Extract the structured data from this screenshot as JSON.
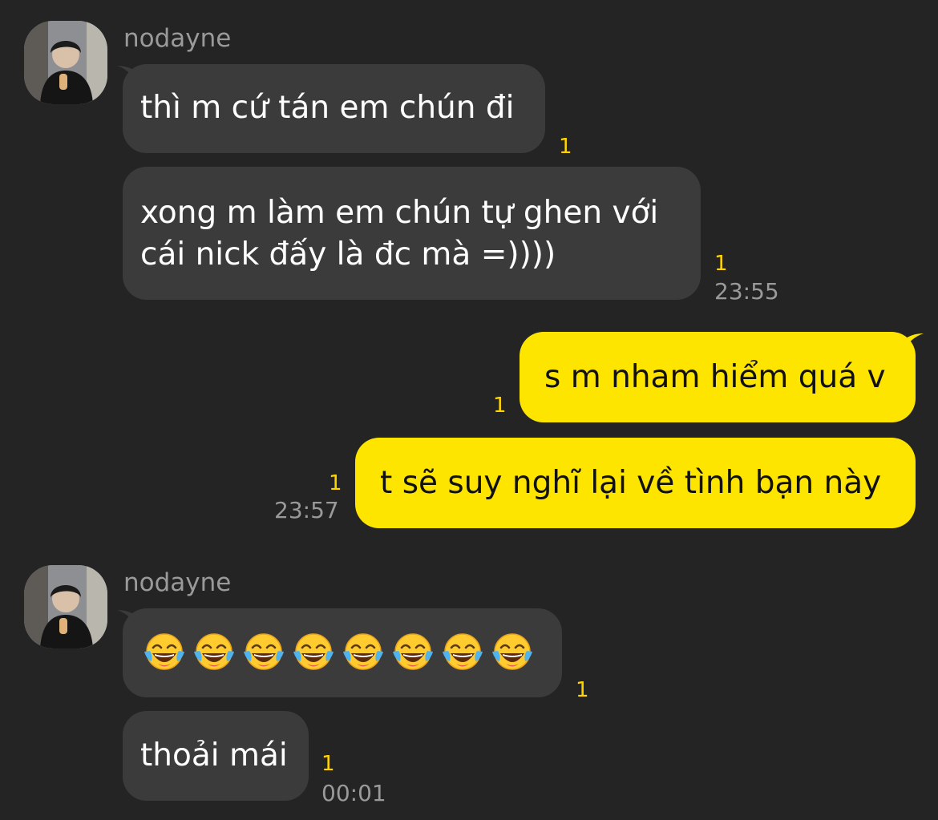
{
  "chat": {
    "groups": [
      {
        "sender": "nodayne",
        "messages": [
          {
            "text": "thì m cứ tán em chún đi",
            "read_count": "1"
          },
          {
            "lines": [
              "xong m làm em chún tự ghen với",
              "cái nick đấy là đc mà =))))"
            ],
            "read_count": "1",
            "time": "23:55"
          }
        ]
      },
      {
        "sender": "me",
        "messages": [
          {
            "text": "s m nham hiểm quá v",
            "read_count": "1"
          },
          {
            "text": "t sẽ suy nghĩ lại về tình bạn này",
            "read_count": "1",
            "time": "23:57"
          }
        ]
      },
      {
        "sender": "nodayne",
        "messages": [
          {
            "emoji": "face-with-tears-of-joy",
            "emoji_count": 8,
            "read_count": "1"
          },
          {
            "text": "thoải mái",
            "read_count": "1",
            "time": "00:01"
          }
        ]
      }
    ]
  },
  "colors": {
    "background": "#242424",
    "incoming_bubble": "#3b3b3b",
    "outgoing_bubble": "#fee500",
    "read_count": "#ffd400",
    "muted_text": "#9a9a9a"
  }
}
